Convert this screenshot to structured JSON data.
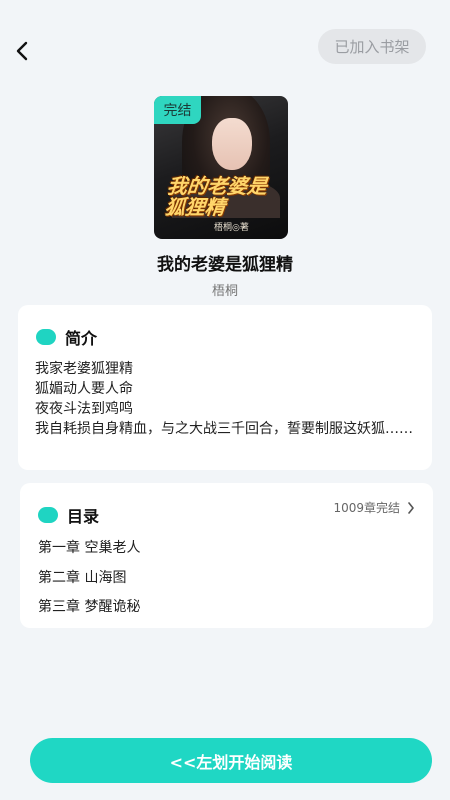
{
  "header": {
    "back_icon": "chevron-left-icon",
    "shelf_label": "已加入书架"
  },
  "book": {
    "status_badge": "完结",
    "cover_title": "我的老婆是狐狸精",
    "cover_author": "梧桐◎著",
    "title": "我的老婆是狐狸精",
    "author": "梧桐"
  },
  "intro": {
    "heading": "简介",
    "lines": [
      "我家老婆狐狸精",
      "狐媚动人要人命",
      "夜夜斗法到鸡鸣",
      "我自耗损自身精血，与之大战三千回合，誓要制服这妖狐……"
    ]
  },
  "toc": {
    "heading": "目录",
    "status": "1009章完结",
    "chevron_icon": "chevron-right-icon",
    "chapters": [
      "第一章 空巢老人",
      "第二章 山海图",
      "第三章  梦醒诡秘"
    ]
  },
  "footer": {
    "read_label": "<<左划开始阅读"
  },
  "colors": {
    "accent": "#1fd7c4",
    "background": "#f2f5f8"
  }
}
